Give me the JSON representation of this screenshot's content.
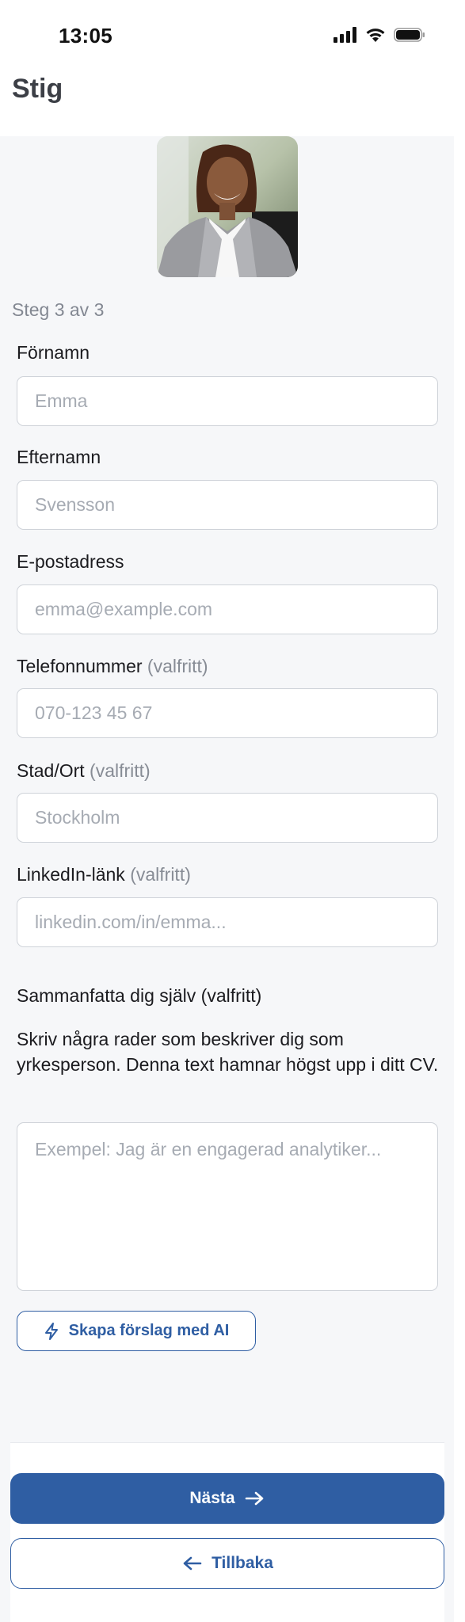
{
  "status_bar": {
    "time": "13:05"
  },
  "header": {
    "title": "Stig"
  },
  "step": "Steg 3 av 3",
  "fields": {
    "first_name": {
      "label": "Förnamn",
      "placeholder": "Emma",
      "value": ""
    },
    "last_name": {
      "label": "Efternamn",
      "placeholder": "Svensson",
      "value": ""
    },
    "email": {
      "label": "E-postadress",
      "placeholder": "emma@example.com",
      "value": ""
    },
    "phone": {
      "label": "Telefonnummer",
      "optional": "(valfritt)",
      "placeholder": "070-123 45 67",
      "value": ""
    },
    "city": {
      "label": "Stad/Ort",
      "optional": "(valfritt)",
      "placeholder": "Stockholm",
      "value": ""
    },
    "linkedin": {
      "label": "LinkedIn-länk",
      "optional": "(valfritt)",
      "placeholder": "linkedin.com/in/emma...",
      "value": ""
    }
  },
  "summary": {
    "title": "Sammanfatta dig själv (valfritt)",
    "description": "Skriv några rader som beskriver dig som yrkesperson. Denna text hamnar högst upp i ditt CV.",
    "placeholder": "Exempel: Jag är en engagerad analytiker...",
    "value": ""
  },
  "ai_button": {
    "label": "Skapa förslag med AI",
    "icon": "lightning-icon"
  },
  "footer": {
    "next_label": "Nästa",
    "next_icon": "arrow-right-icon",
    "back_label": "Tillbaka",
    "back_icon": "arrow-left-icon"
  },
  "colors": {
    "primary": "#2f5ea3",
    "background": "#f6f7f9",
    "placeholder": "#a6abb3",
    "muted": "#878c95"
  }
}
